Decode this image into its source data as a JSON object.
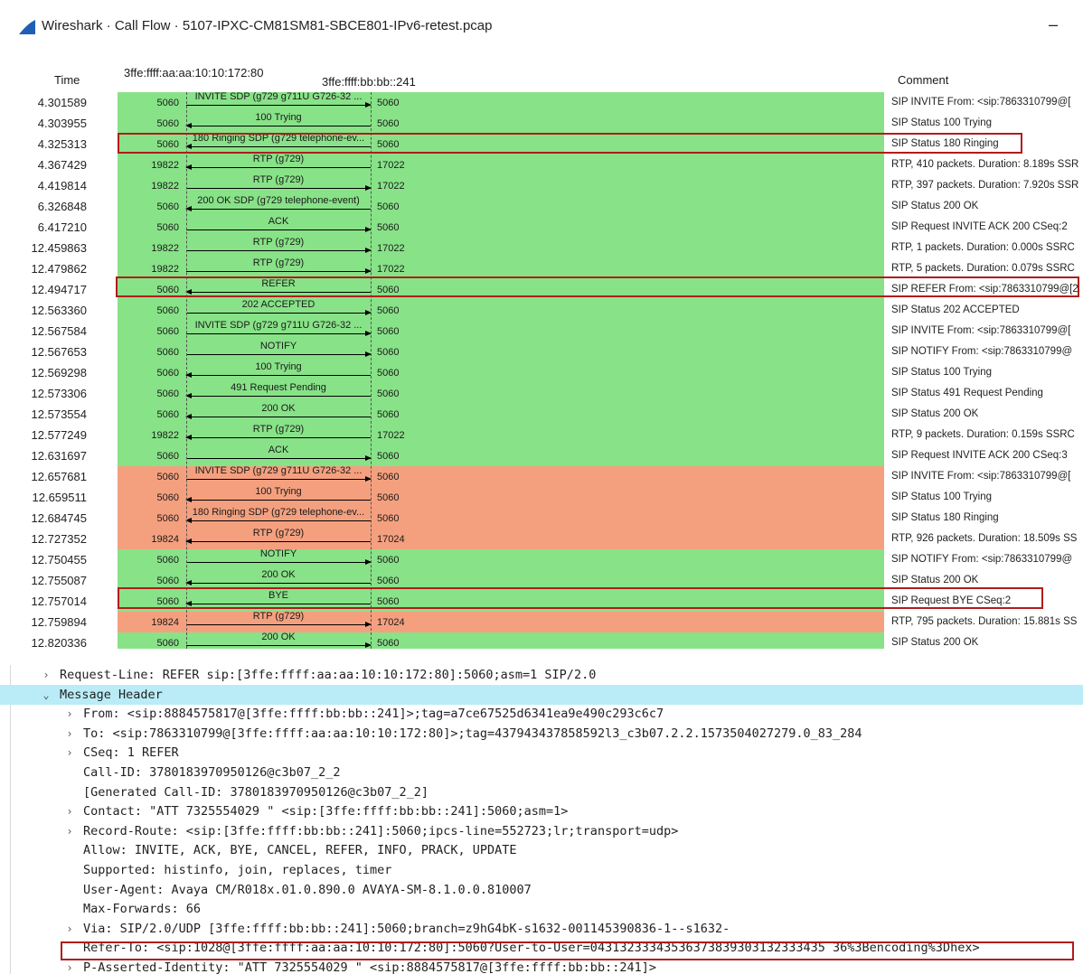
{
  "window": {
    "title": "Wireshark · Call Flow · 5107-IPXC-CM81SM81-SBCE801-IPv6-retest.pcap",
    "minimize_label": "–"
  },
  "flow_header": {
    "time": "Time",
    "node_a": "3ffe:ffff:aa:aa:10:10:172:80",
    "node_b": "3ffe:ffff:bb:bb::241",
    "comment": "Comment"
  },
  "colors": {
    "green": "#88e288",
    "salmon": "#f4a07f",
    "highlight": "#b01c1c",
    "selected_row": "#b9ecf7"
  },
  "flows": [
    {
      "time": "4.301589",
      "port_a": "5060",
      "label": "INVITE SDP (g729 g711U G726-32 ...",
      "port_b": "5060",
      "dir": "right",
      "color": "green",
      "comment": "SIP INVITE From: <sip:7863310799@["
    },
    {
      "time": "4.303955",
      "port_a": "5060",
      "label": "100 Trying",
      "port_b": "5060",
      "dir": "left",
      "color": "green",
      "comment": "SIP Status 100 Trying"
    },
    {
      "time": "4.325313",
      "port_a": "5060",
      "label": "180 Ringing SDP (g729 telephone-ev...",
      "port_b": "5060",
      "dir": "left",
      "color": "green",
      "comment": "SIP Status 180 Ringing"
    },
    {
      "time": "4.367429",
      "port_a": "19822",
      "label": "RTP (g729)",
      "port_b": "17022",
      "dir": "left",
      "color": "green",
      "comment": "RTP, 410 packets. Duration: 8.189s SSR"
    },
    {
      "time": "4.419814",
      "port_a": "19822",
      "label": "RTP (g729)",
      "port_b": "17022",
      "dir": "right",
      "color": "green",
      "comment": "RTP, 397 packets. Duration: 7.920s SSR"
    },
    {
      "time": "6.326848",
      "port_a": "5060",
      "label": "200 OK SDP (g729 telephone-event)",
      "port_b": "5060",
      "dir": "left",
      "color": "green",
      "comment": "SIP Status 200 OK"
    },
    {
      "time": "6.417210",
      "port_a": "5060",
      "label": "ACK",
      "port_b": "5060",
      "dir": "right",
      "color": "green",
      "comment": "SIP Request INVITE ACK 200 CSeq:2"
    },
    {
      "time": "12.459863",
      "port_a": "19822",
      "label": "RTP (g729)",
      "port_b": "17022",
      "dir": "right",
      "color": "green",
      "comment": "RTP, 1 packets. Duration: 0.000s SSRC"
    },
    {
      "time": "12.479862",
      "port_a": "19822",
      "label": "RTP (g729)",
      "port_b": "17022",
      "dir": "right",
      "color": "green",
      "comment": "RTP, 5 packets. Duration: 0.079s SSRC"
    },
    {
      "time": "12.494717",
      "port_a": "5060",
      "label": "REFER",
      "port_b": "5060",
      "dir": "left",
      "color": "green",
      "comment": "SIP REFER From: <sip:7863310799@[2"
    },
    {
      "time": "12.563360",
      "port_a": "5060",
      "label": "202 ACCEPTED",
      "port_b": "5060",
      "dir": "right",
      "color": "green",
      "comment": "SIP Status 202 ACCEPTED"
    },
    {
      "time": "12.567584",
      "port_a": "5060",
      "label": "INVITE SDP (g729 g711U G726-32 ...",
      "port_b": "5060",
      "dir": "right",
      "color": "green",
      "comment": "SIP INVITE From: <sip:7863310799@["
    },
    {
      "time": "12.567653",
      "port_a": "5060",
      "label": "NOTIFY",
      "port_b": "5060",
      "dir": "right",
      "color": "green",
      "comment": "SIP NOTIFY From: <sip:7863310799@"
    },
    {
      "time": "12.569298",
      "port_a": "5060",
      "label": "100 Trying",
      "port_b": "5060",
      "dir": "left",
      "color": "green",
      "comment": "SIP Status 100 Trying"
    },
    {
      "time": "12.573306",
      "port_a": "5060",
      "label": "491 Request Pending",
      "port_b": "5060",
      "dir": "left",
      "color": "green",
      "comment": "SIP Status 491 Request Pending"
    },
    {
      "time": "12.573554",
      "port_a": "5060",
      "label": "200 OK",
      "port_b": "5060",
      "dir": "left",
      "color": "green",
      "comment": "SIP Status 200 OK"
    },
    {
      "time": "12.577249",
      "port_a": "19822",
      "label": "RTP (g729)",
      "port_b": "17022",
      "dir": "left",
      "color": "green",
      "comment": "RTP, 9 packets. Duration: 0.159s SSRC"
    },
    {
      "time": "12.631697",
      "port_a": "5060",
      "label": "ACK",
      "port_b": "5060",
      "dir": "right",
      "color": "green",
      "comment": "SIP Request INVITE ACK 200 CSeq:3"
    },
    {
      "time": "12.657681",
      "port_a": "5060",
      "label": "INVITE SDP (g729 g711U G726-32 ...",
      "port_b": "5060",
      "dir": "right",
      "color": "salmon",
      "comment": "SIP INVITE From: <sip:7863310799@["
    },
    {
      "time": "12.659511",
      "port_a": "5060",
      "label": "100 Trying",
      "port_b": "5060",
      "dir": "left",
      "color": "salmon",
      "comment": "SIP Status 100 Trying"
    },
    {
      "time": "12.684745",
      "port_a": "5060",
      "label": "180 Ringing SDP (g729 telephone-ev...",
      "port_b": "5060",
      "dir": "left",
      "color": "salmon",
      "comment": "SIP Status 180 Ringing"
    },
    {
      "time": "12.727352",
      "port_a": "19824",
      "label": "RTP (g729)",
      "port_b": "17024",
      "dir": "left",
      "color": "salmon",
      "comment": "RTP, 926 packets. Duration: 18.509s SS"
    },
    {
      "time": "12.750455",
      "port_a": "5060",
      "label": "NOTIFY",
      "port_b": "5060",
      "dir": "right",
      "color": "green",
      "comment": "SIP NOTIFY From: <sip:7863310799@"
    },
    {
      "time": "12.755087",
      "port_a": "5060",
      "label": "200 OK",
      "port_b": "5060",
      "dir": "left",
      "color": "green",
      "comment": "SIP Status 200 OK"
    },
    {
      "time": "12.757014",
      "port_a": "5060",
      "label": "BYE",
      "port_b": "5060",
      "dir": "left",
      "color": "green",
      "comment": "SIP Request BYE CSeq:2"
    },
    {
      "time": "12.759894",
      "port_a": "19824",
      "label": "RTP (g729)",
      "port_b": "17024",
      "dir": "right",
      "color": "salmon",
      "comment": "RTP, 795 packets. Duration: 15.881s SS"
    },
    {
      "time": "12.820336",
      "port_a": "5060",
      "label": "200 OK",
      "port_b": "5060",
      "dir": "right",
      "color": "green",
      "comment": "SIP Status 200 OK"
    }
  ],
  "details": [
    {
      "expander": "›",
      "indent": 1,
      "text": "Request-Line: REFER sip:[3ffe:ffff:aa:aa:10:10:172:80]:5060;asm=1 SIP/2.0",
      "selected": false
    },
    {
      "expander": "⌄",
      "indent": 1,
      "text": "Message Header",
      "selected": true
    },
    {
      "expander": "›",
      "indent": 2,
      "text": "From: <sip:8884575817@[3ffe:ffff:bb:bb::241]>;tag=a7ce67525d6341ea9e490c293c6c7",
      "selected": false
    },
    {
      "expander": "›",
      "indent": 2,
      "text": "To: <sip:7863310799@[3ffe:ffff:aa:aa:10:10:172:80]>;tag=437943437858592l3_c3b07.2.2.1573504027279.0_83_284",
      "selected": false
    },
    {
      "expander": "›",
      "indent": 2,
      "text": "CSeq: 1 REFER",
      "selected": false
    },
    {
      "expander": "",
      "indent": 2,
      "text": "Call-ID: 3780183970950126@c3b07_2_2",
      "selected": false
    },
    {
      "expander": "",
      "indent": 2,
      "text": "[Generated Call-ID: 3780183970950126@c3b07_2_2]",
      "selected": false
    },
    {
      "expander": "›",
      "indent": 2,
      "text": "Contact: \"ATT 7325554029 \" <sip:[3ffe:ffff:bb:bb::241]:5060;asm=1>",
      "selected": false
    },
    {
      "expander": "›",
      "indent": 2,
      "text": "Record-Route: <sip:[3ffe:ffff:bb:bb::241]:5060;ipcs-line=552723;lr;transport=udp>",
      "selected": false
    },
    {
      "expander": "",
      "indent": 2,
      "text": "Allow: INVITE, ACK, BYE, CANCEL, REFER, INFO, PRACK, UPDATE",
      "selected": false
    },
    {
      "expander": "",
      "indent": 2,
      "text": "Supported: histinfo, join, replaces, timer",
      "selected": false
    },
    {
      "expander": "",
      "indent": 2,
      "text": "User-Agent: Avaya CM/R018x.01.0.890.0 AVAYA-SM-8.1.0.0.810007",
      "selected": false
    },
    {
      "expander": "",
      "indent": 2,
      "text": "Max-Forwards: 66",
      "selected": false
    },
    {
      "expander": "›",
      "indent": 2,
      "text": "Via: SIP/2.0/UDP [3ffe:ffff:bb:bb::241]:5060;branch=z9hG4bK-s1632-001145390836-1--s1632-",
      "selected": false
    },
    {
      "expander": "",
      "indent": 2,
      "text": "Refer-To: <sip:1028@[3ffe:ffff:aa:aa:10:10:172:80]:5060?User-to-User=04313233343536373839303132333435 36%3Bencoding%3Dhex>",
      "selected": false
    },
    {
      "expander": "›",
      "indent": 2,
      "text": "P-Asserted-Identity: \"ATT 7325554029 \" <sip:8884575817@[3ffe:ffff:bb:bb::241]>",
      "selected": false
    }
  ]
}
